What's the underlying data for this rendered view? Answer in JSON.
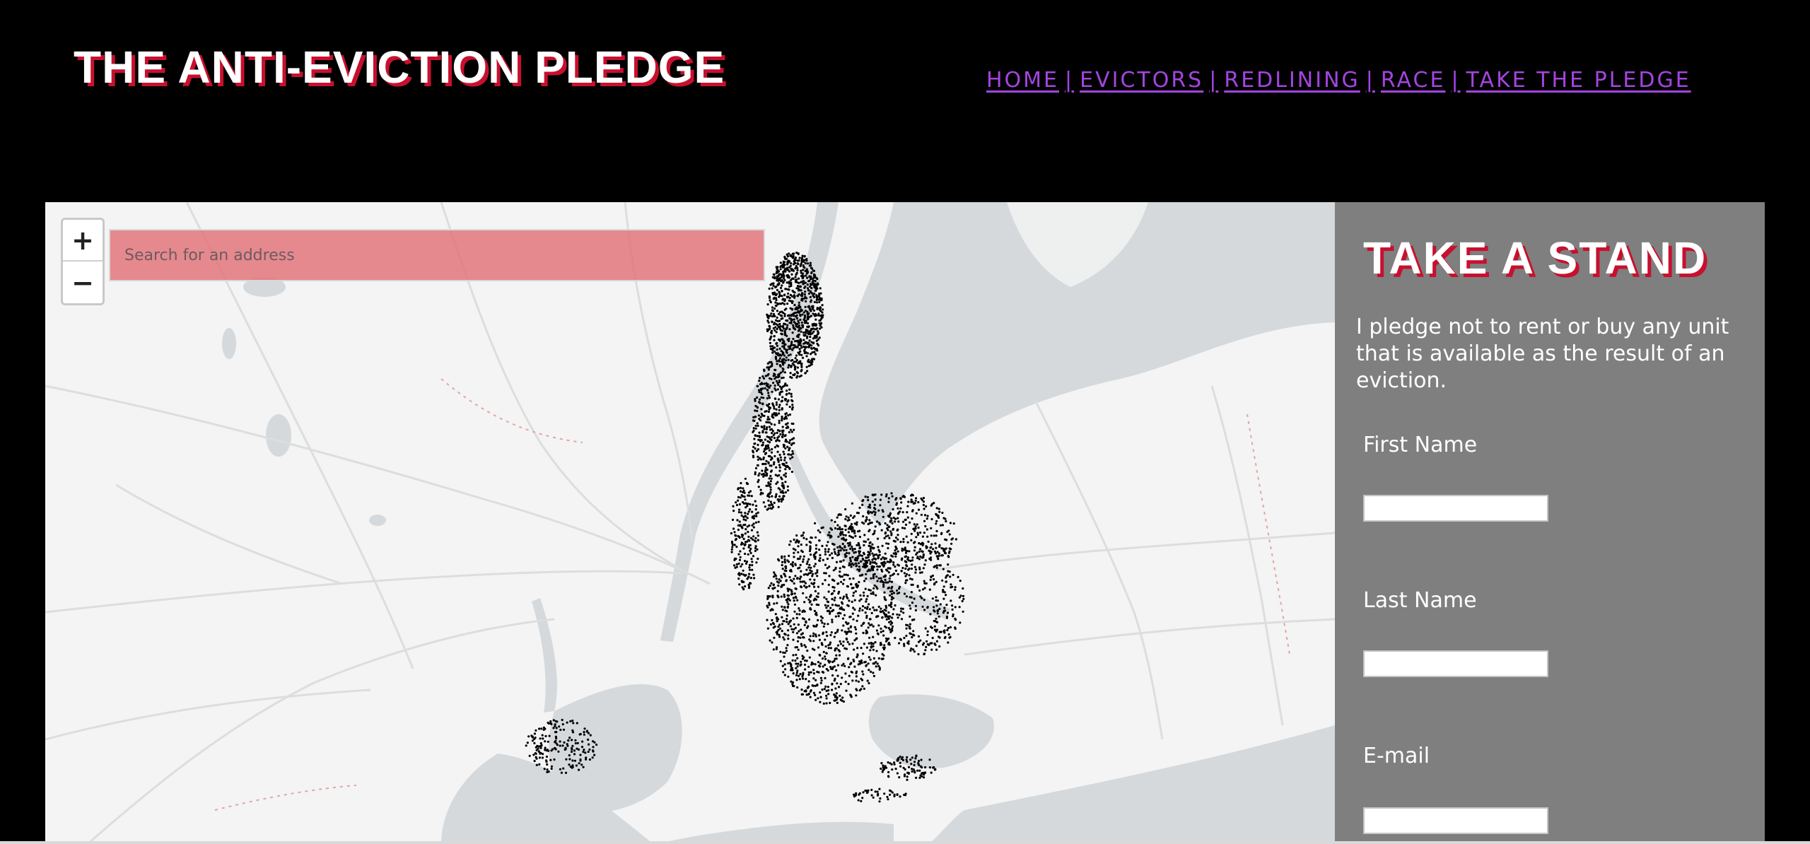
{
  "header": {
    "title": "THE ANTI-EVICTION PLEDGE",
    "nav": [
      {
        "label": "HOME"
      },
      {
        "label": "EVICTORS"
      },
      {
        "label": "REDLINING"
      },
      {
        "label": "RACE"
      },
      {
        "label": "TAKE THE PLEDGE"
      }
    ],
    "separator": "|"
  },
  "map": {
    "zoom_in": "+",
    "zoom_out": "−",
    "search": {
      "placeholder": "Search for an address",
      "value": ""
    }
  },
  "panel": {
    "title": "TAKE A STAND",
    "pledge_text": "I pledge not to rent or buy any unit that is available as the result of an eviction.",
    "fields": [
      {
        "label": "First Name",
        "value": ""
      },
      {
        "label": "Last Name",
        "value": ""
      },
      {
        "label": "E-mail",
        "value": ""
      }
    ]
  },
  "colors": {
    "background": "#000000",
    "title_shadow": "#c8102e",
    "nav_link": "#a445e0",
    "panel": "#7f7f7f",
    "search_box": "#e27279",
    "water": "#d5d9dc",
    "land": "#f3f4f3",
    "eviction_dot": "#000000"
  }
}
